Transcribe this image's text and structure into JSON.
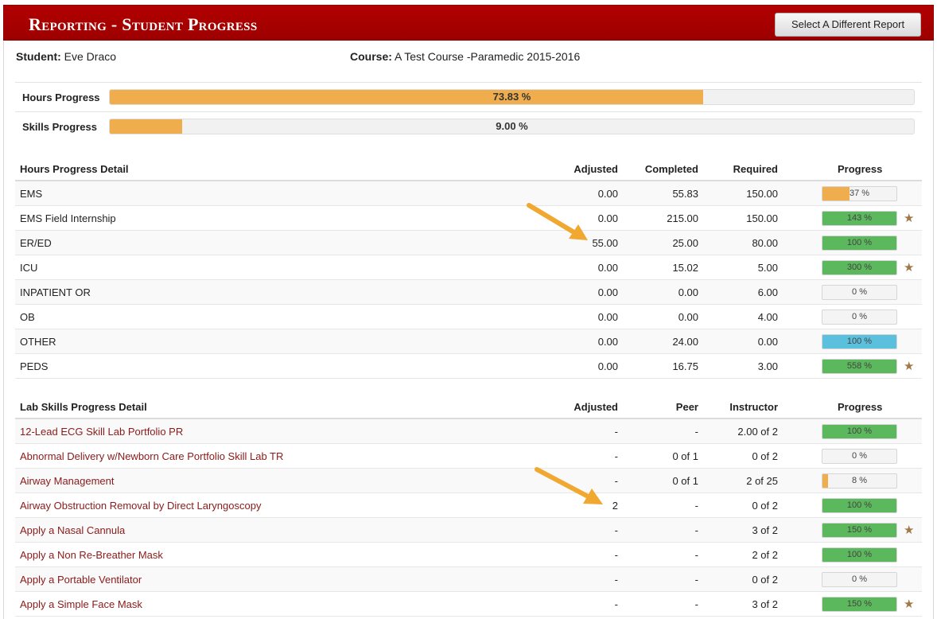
{
  "header": {
    "title": "Reporting - Student Progress",
    "button_label": "Select A Different Report"
  },
  "student": {
    "label": "Student:",
    "name": "Eve Draco"
  },
  "course": {
    "label": "Course:",
    "name": "A Test Course -Paramedic 2015-2016"
  },
  "summary": {
    "hours": {
      "label": "Hours Progress",
      "percent_text": "73.83 %",
      "fraction": 0.7383,
      "color": "#f0ad4e"
    },
    "skills": {
      "label": "Skills Progress",
      "percent_text": "9.00 %",
      "fraction": 0.09,
      "color": "#f0ad4e"
    }
  },
  "hours_detail": {
    "headers": {
      "name": "Hours Progress Detail",
      "adjusted": "Adjusted",
      "completed": "Completed",
      "required": "Required",
      "progress": "Progress"
    },
    "rows": [
      {
        "name": "EMS",
        "adjusted": "0.00",
        "completed": "55.83",
        "required": "150.00",
        "progress": "37 %",
        "fraction": 0.37,
        "color": "#f0ad4e",
        "star": false
      },
      {
        "name": "EMS Field Internship",
        "adjusted": "0.00",
        "completed": "215.00",
        "required": "150.00",
        "progress": "143 %",
        "fraction": 1,
        "color": "#5cb85c",
        "star": true
      },
      {
        "name": "ER/ED",
        "adjusted": "55.00",
        "completed": "25.00",
        "required": "80.00",
        "progress": "100 %",
        "fraction": 1,
        "color": "#5cb85c",
        "star": false
      },
      {
        "name": "ICU",
        "adjusted": "0.00",
        "completed": "15.02",
        "required": "5.00",
        "progress": "300 %",
        "fraction": 1,
        "color": "#5cb85c",
        "star": true
      },
      {
        "name": "INPATIENT OR",
        "adjusted": "0.00",
        "completed": "0.00",
        "required": "6.00",
        "progress": "0 %",
        "fraction": 0,
        "color": "#f0ad4e",
        "star": false
      },
      {
        "name": "OB",
        "adjusted": "0.00",
        "completed": "0.00",
        "required": "4.00",
        "progress": "0 %",
        "fraction": 0,
        "color": "#f0ad4e",
        "star": false
      },
      {
        "name": "OTHER",
        "adjusted": "0.00",
        "completed": "24.00",
        "required": "0.00",
        "progress": "100 %",
        "fraction": 1,
        "color": "#5bc0de",
        "star": false
      },
      {
        "name": "PEDS",
        "adjusted": "0.00",
        "completed": "16.75",
        "required": "3.00",
        "progress": "558 %",
        "fraction": 1,
        "color": "#5cb85c",
        "star": true
      }
    ]
  },
  "skills_detail": {
    "headers": {
      "name": "Lab Skills Progress Detail",
      "adjusted": "Adjusted",
      "peer": "Peer",
      "instructor": "Instructor",
      "progress": "Progress"
    },
    "rows": [
      {
        "name": "12-Lead ECG Skill Lab Portfolio PR",
        "adjusted": "-",
        "peer": "-",
        "instructor": "2.00 of 2",
        "progress": "100 %",
        "fraction": 1,
        "color": "#5cb85c",
        "star": false
      },
      {
        "name": "Abnormal Delivery w/Newborn Care Portfolio Skill Lab TR",
        "adjusted": "-",
        "peer": "0 of 1",
        "instructor": "0 of 2",
        "progress": "0 %",
        "fraction": 0,
        "color": "#f0ad4e",
        "star": false
      },
      {
        "name": "Airway Management",
        "adjusted": "-",
        "peer": "0 of 1",
        "instructor": "2 of 25",
        "progress": "8 %",
        "fraction": 0.08,
        "color": "#f0ad4e",
        "star": false
      },
      {
        "name": "Airway Obstruction Removal by Direct Laryngoscopy",
        "adjusted": "2",
        "peer": "-",
        "instructor": "0 of 2",
        "progress": "100 %",
        "fraction": 1,
        "color": "#5cb85c",
        "star": false
      },
      {
        "name": "Apply a Nasal Cannula",
        "adjusted": "-",
        "peer": "-",
        "instructor": "3 of 2",
        "progress": "150 %",
        "fraction": 1,
        "color": "#5cb85c",
        "star": true
      },
      {
        "name": "Apply a Non Re-Breather Mask",
        "adjusted": "-",
        "peer": "-",
        "instructor": "2 of 2",
        "progress": "100 %",
        "fraction": 1,
        "color": "#5cb85c",
        "star": false
      },
      {
        "name": "Apply a Portable Ventilator",
        "adjusted": "-",
        "peer": "-",
        "instructor": "0 of 2",
        "progress": "0 %",
        "fraction": 0,
        "color": "#f0ad4e",
        "star": false
      },
      {
        "name": "Apply a Simple Face Mask",
        "adjusted": "-",
        "peer": "-",
        "instructor": "3 of 2",
        "progress": "150 %",
        "fraction": 1,
        "color": "#5cb85c",
        "star": true
      }
    ]
  },
  "icons": {
    "star": "star-icon",
    "arrow": "annotation-arrow"
  }
}
